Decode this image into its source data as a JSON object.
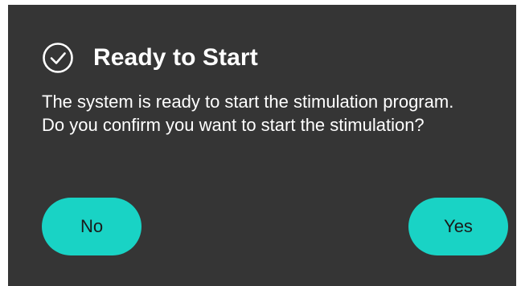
{
  "dialog": {
    "title": "Ready to Start",
    "title_icon": "check-circle-icon",
    "message_lines": [
      "The system is ready to start the stimulation program.",
      "Do you confirm you want to start the stimulation?"
    ],
    "no_label": "No",
    "yes_label": "Yes"
  },
  "colors": {
    "background": "#353535",
    "accent": "#19d3c5",
    "text": "#ffffff",
    "button_text": "#1a1a1a"
  }
}
